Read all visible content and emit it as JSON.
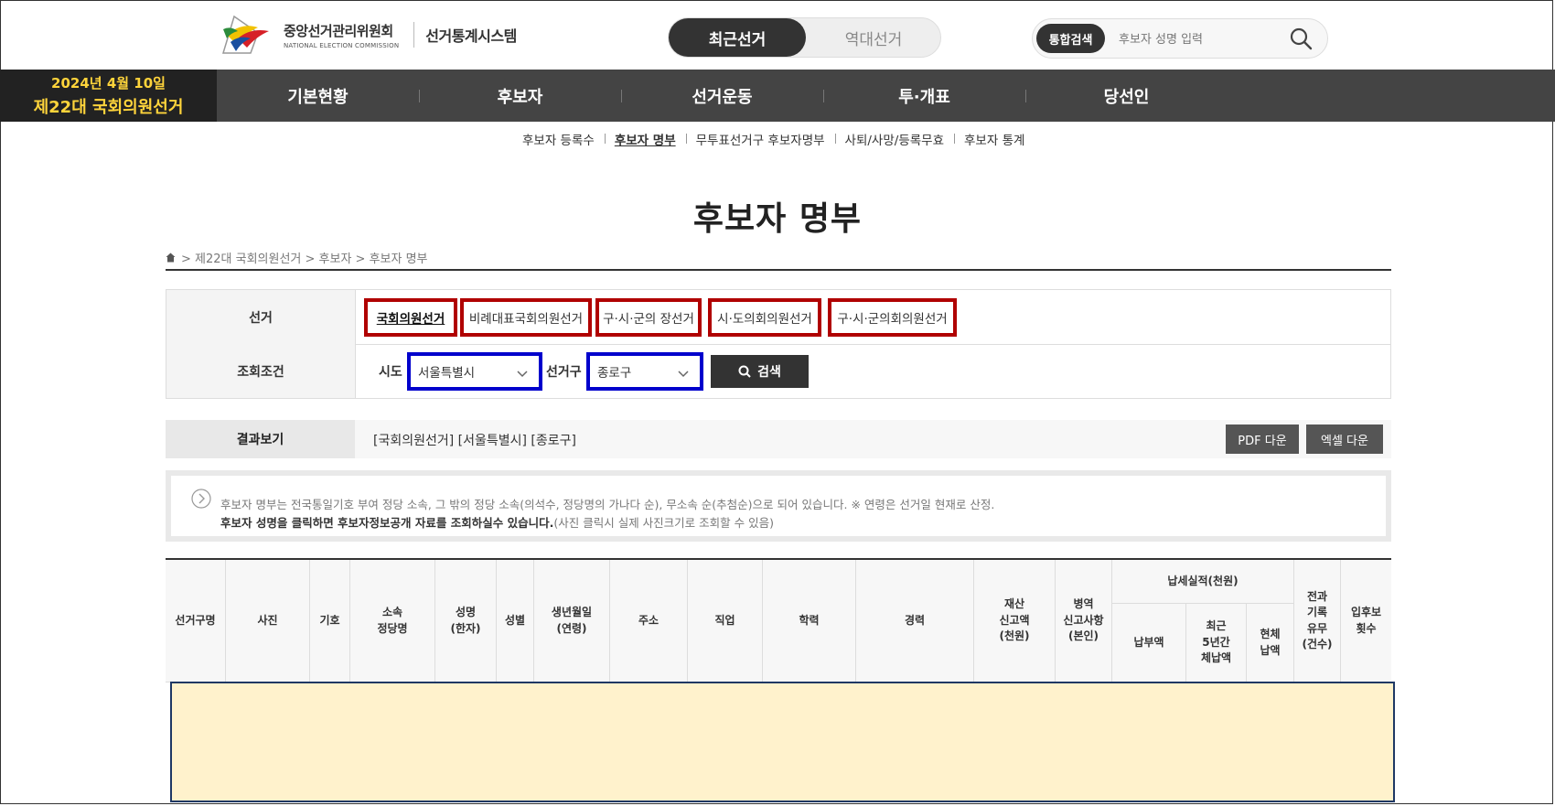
{
  "header": {
    "org_name": "중앙선거관리위원회",
    "org_name_en": "NATIONAL ELECTION COMMISSION",
    "system_name": "선거통계시스템",
    "toggle": {
      "active": "최근선거",
      "inactive": "역대선거"
    },
    "search": {
      "badge": "통합검색",
      "placeholder": "후보자 성명 입력",
      "icon": "search-icon"
    }
  },
  "nav": {
    "election_date": "2024년 4월 10일",
    "election_name": "제22대 국회의원선거",
    "items": [
      "기본현황",
      "후보자",
      "선거운동",
      "투·개표",
      "당선인"
    ]
  },
  "subnav": {
    "items": [
      "후보자 등록수",
      "후보자 명부",
      "무투표선거구 후보자명부",
      "사퇴/사망/등록무효",
      "후보자 통계"
    ],
    "active_index": 1
  },
  "page_title": "후보자 명부",
  "breadcrumb": "> 제22대 국회의원선거 > 후보자 > 후보자 명부",
  "filter": {
    "election_label": "선거",
    "election_tabs": [
      "국회의원선거",
      "비례대표국회의원선거",
      "구·시·군의 장선거",
      "시·도의회의원선거",
      "구·시·군의회의원선거"
    ],
    "condition_label": "조회조건",
    "sido_label": "시도",
    "sido_value": "서울특별시",
    "district_label": "선거구",
    "district_value": "종로구",
    "search_button": "검색"
  },
  "result": {
    "label": "결과보기",
    "value": "[국회의원선거] [서울특별시] [종로구]",
    "pdf_button": "PDF 다운",
    "excel_button": "엑셀 다운"
  },
  "notice": {
    "line1": "후보자 명부는 전국통일기호 부여 정당 소속, 그 밖의 정당 소속(의석수, 정당명의 가나다 순), 무소속 순(추첨순)으로 되어 있습니다. ※ 연령은 선거일 현재로 산정.",
    "line2_bold": "후보자 성명을 클릭하면 후보자정보공개 자료를 조회하실수 있습니다.",
    "line2_rest": "(사진 클릭시 실제 사진크기로 조회할 수 있음)"
  },
  "table": {
    "headers": [
      "선거구명",
      "사진",
      "기호",
      "소속\n정당명",
      "성명\n(한자)",
      "성별",
      "생년월일\n(연령)",
      "주소",
      "직업",
      "학력",
      "경력",
      "재산\n신고액\n(천원)",
      "병역\n신고사항\n(본인)",
      "납세실적(천원)",
      "전과\n기록\n유무\n(건수)",
      "입후보\n횟수"
    ],
    "tax_subheaders": [
      "납부액",
      "최근\n5년간\n체납액",
      "현체\n납액"
    ]
  },
  "colors": {
    "tab_highlight": "#b00000",
    "select_highlight": "#0000cc",
    "nav_date": "#ffd43b",
    "result_fill": "#fff2cc"
  }
}
